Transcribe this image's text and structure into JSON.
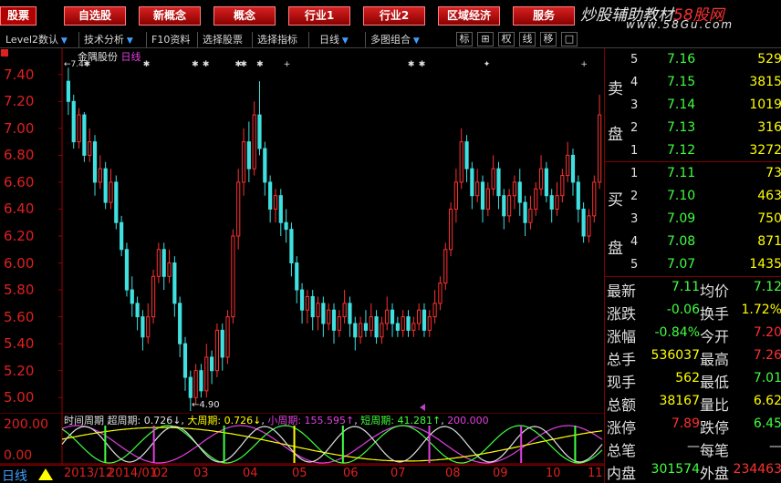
{
  "topbar": {
    "buttons": [
      "股票",
      "自选股",
      "新概念",
      "概念",
      "行业1",
      "行业2",
      "区域经济",
      "服务"
    ]
  },
  "brand": {
    "title_prefix": "炒股辅助教材",
    "title_highlight": "58股网",
    "url": "www.58Gu.com"
  },
  "toolbar": {
    "items": [
      "Level2数认",
      "技术分析",
      "F10资料",
      "选择股票",
      "选择指标",
      "日线",
      "多图组合"
    ],
    "small_buttons": [
      "标",
      "⊞",
      "权",
      "线",
      "移",
      "□"
    ]
  },
  "chart": {
    "stock_name": "金隅股份",
    "period": "日线",
    "max_label": "7.4",
    "min_label": "4.90",
    "y_labels": [
      "7.40",
      "7.20",
      "7.00",
      "6.80",
      "6.60",
      "6.40",
      "6.20",
      "6.00",
      "5.80",
      "5.60",
      "5.40",
      "5.20",
      "5.00"
    ],
    "colors": {
      "up": "#ff3030",
      "down": "#40e0e0",
      "axis": "#e02020",
      "grid": "#800000"
    }
  },
  "chart_data": {
    "type": "candlestick",
    "ylim": [
      4.9,
      7.5
    ],
    "candles": [
      [
        7.35,
        7.2,
        7.45,
        7.1
      ],
      [
        7.2,
        6.9,
        7.25,
        6.85
      ],
      [
        6.9,
        7.1,
        7.15,
        6.85
      ],
      [
        7.1,
        6.8,
        7.12,
        6.75
      ],
      [
        6.8,
        6.9,
        7.0,
        6.75
      ],
      [
        6.9,
        6.6,
        6.95,
        6.5
      ],
      [
        6.6,
        6.7,
        6.8,
        6.55
      ],
      [
        6.7,
        6.45,
        6.75,
        6.4
      ],
      [
        6.45,
        6.6,
        6.7,
        6.4
      ],
      [
        6.6,
        6.3,
        6.65,
        6.25
      ],
      [
        6.3,
        6.1,
        6.35,
        6.05
      ],
      [
        6.1,
        5.8,
        6.15,
        5.75
      ],
      [
        5.8,
        5.7,
        5.9,
        5.6
      ],
      [
        5.7,
        5.6,
        5.75,
        5.5
      ],
      [
        5.6,
        5.45,
        5.65,
        5.35
      ],
      [
        5.45,
        5.6,
        5.7,
        5.4
      ],
      [
        5.6,
        5.9,
        5.95,
        5.55
      ],
      [
        5.9,
        6.1,
        6.15,
        5.85
      ],
      [
        6.1,
        5.9,
        6.15,
        5.8
      ],
      [
        5.9,
        6.0,
        6.1,
        5.85
      ],
      [
        6.0,
        5.7,
        6.05,
        5.6
      ],
      [
        5.7,
        5.4,
        5.75,
        5.3
      ],
      [
        5.4,
        5.15,
        5.45,
        5.05
      ],
      [
        5.15,
        5.0,
        5.2,
        4.9
      ],
      [
        5.0,
        5.2,
        5.25,
        4.95
      ],
      [
        5.2,
        5.05,
        5.25,
        5.0
      ],
      [
        5.05,
        5.3,
        5.4,
        5.0
      ],
      [
        5.3,
        5.2,
        5.35,
        5.1
      ],
      [
        5.2,
        5.5,
        5.55,
        5.15
      ],
      [
        5.5,
        5.3,
        5.55,
        5.2
      ],
      [
        5.3,
        5.6,
        5.65,
        5.25
      ],
      [
        5.6,
        6.2,
        6.25,
        5.55
      ],
      [
        6.2,
        6.6,
        6.7,
        6.1
      ],
      [
        6.6,
        6.9,
        7.0,
        6.5
      ],
      [
        6.9,
        6.7,
        7.05,
        6.6
      ],
      [
        6.7,
        7.1,
        7.2,
        6.65
      ],
      [
        7.1,
        6.85,
        7.35,
        6.8
      ],
      [
        6.85,
        6.6,
        6.9,
        6.5
      ],
      [
        6.6,
        6.4,
        6.65,
        6.3
      ],
      [
        6.4,
        6.5,
        6.55,
        6.3
      ],
      [
        6.5,
        6.3,
        6.55,
        6.2
      ],
      [
        6.3,
        6.25,
        6.4,
        6.15
      ],
      [
        6.25,
        6.0,
        6.3,
        5.9
      ],
      [
        6.0,
        5.8,
        6.05,
        5.7
      ],
      [
        5.8,
        5.65,
        5.85,
        5.55
      ],
      [
        5.65,
        5.75,
        5.8,
        5.55
      ],
      [
        5.75,
        5.6,
        5.8,
        5.5
      ],
      [
        5.6,
        5.7,
        5.75,
        5.5
      ],
      [
        5.7,
        5.55,
        5.75,
        5.45
      ],
      [
        5.55,
        5.65,
        5.7,
        5.5
      ],
      [
        5.65,
        5.5,
        5.7,
        5.4
      ],
      [
        5.5,
        5.6,
        5.65,
        5.45
      ],
      [
        5.6,
        5.7,
        5.8,
        5.55
      ],
      [
        5.7,
        5.55,
        5.75,
        5.45
      ],
      [
        5.55,
        5.45,
        5.6,
        5.35
      ],
      [
        5.45,
        5.55,
        5.6,
        5.4
      ],
      [
        5.55,
        5.5,
        5.65,
        5.45
      ],
      [
        5.5,
        5.6,
        5.7,
        5.45
      ],
      [
        5.6,
        5.45,
        5.65,
        5.4
      ],
      [
        5.45,
        5.55,
        5.6,
        5.4
      ],
      [
        5.55,
        5.65,
        5.75,
        5.5
      ],
      [
        5.65,
        5.55,
        5.7,
        5.45
      ],
      [
        5.55,
        5.5,
        5.6,
        5.45
      ],
      [
        5.5,
        5.6,
        5.65,
        5.45
      ],
      [
        5.6,
        5.5,
        5.65,
        5.45
      ],
      [
        5.5,
        5.55,
        5.6,
        5.45
      ],
      [
        5.55,
        5.65,
        5.7,
        5.5
      ],
      [
        5.65,
        5.5,
        5.7,
        5.45
      ],
      [
        5.5,
        5.6,
        5.65,
        5.45
      ],
      [
        5.6,
        5.7,
        5.8,
        5.55
      ],
      [
        5.7,
        5.85,
        5.9,
        5.65
      ],
      [
        5.85,
        6.1,
        6.15,
        5.8
      ],
      [
        6.1,
        6.4,
        6.45,
        6.05
      ],
      [
        6.4,
        6.6,
        6.7,
        6.3
      ],
      [
        6.6,
        6.9,
        7.0,
        6.55
      ],
      [
        6.9,
        6.7,
        6.95,
        6.6
      ],
      [
        6.7,
        6.5,
        6.75,
        6.4
      ],
      [
        6.5,
        6.6,
        6.7,
        6.45
      ],
      [
        6.6,
        6.4,
        6.65,
        6.3
      ],
      [
        6.4,
        6.55,
        6.6,
        6.35
      ],
      [
        6.55,
        6.7,
        6.8,
        6.5
      ],
      [
        6.7,
        6.5,
        6.75,
        6.4
      ],
      [
        6.5,
        6.35,
        6.55,
        6.25
      ],
      [
        6.35,
        6.5,
        6.55,
        6.3
      ],
      [
        6.5,
        6.6,
        6.65,
        6.4
      ],
      [
        6.6,
        6.45,
        6.7,
        6.35
      ],
      [
        6.45,
        6.3,
        6.5,
        6.2
      ],
      [
        6.3,
        6.4,
        6.5,
        6.25
      ],
      [
        6.4,
        6.55,
        6.6,
        6.35
      ],
      [
        6.55,
        6.7,
        6.8,
        6.5
      ],
      [
        6.7,
        6.5,
        6.75,
        6.45
      ],
      [
        6.5,
        6.4,
        6.55,
        6.3
      ],
      [
        6.4,
        6.5,
        6.6,
        6.35
      ],
      [
        6.5,
        6.65,
        6.7,
        6.45
      ],
      [
        6.65,
        6.8,
        6.9,
        6.6
      ],
      [
        6.8,
        6.6,
        6.85,
        6.5
      ],
      [
        6.6,
        6.4,
        6.65,
        6.3
      ],
      [
        6.4,
        6.2,
        6.45,
        6.15
      ],
      [
        6.2,
        6.35,
        6.4,
        6.15
      ],
      [
        6.35,
        6.6,
        6.65,
        6.3
      ],
      [
        6.6,
        7.1,
        7.25,
        6.55
      ]
    ],
    "indicator": {
      "name": "时间周期",
      "super_label": "超周期: 0.726↓",
      "big_label": "大周期: 0.726↓",
      "small_label": "小周期: 155.595↑",
      "short_label": "短周期: 41.281↑",
      "value_label": "200.000",
      "ylim": [
        0,
        200
      ],
      "y_labels": [
        "200.00",
        "0.00"
      ]
    },
    "months": [
      "2013/12",
      "2014/01",
      "02",
      "03",
      "04",
      "05",
      "06",
      "07",
      "08",
      "09",
      "10",
      "11"
    ]
  },
  "bottombar": {
    "period": "日线"
  },
  "order_book": {
    "sell_label": [
      "卖",
      "盘"
    ],
    "buy_label": [
      "买",
      "盘"
    ],
    "sell": [
      {
        "idx": "5",
        "price": "7.16",
        "vol": "529"
      },
      {
        "idx": "4",
        "price": "7.15",
        "vol": "3815"
      },
      {
        "idx": "3",
        "price": "7.14",
        "vol": "1019"
      },
      {
        "idx": "2",
        "price": "7.13",
        "vol": "316"
      },
      {
        "idx": "1",
        "price": "7.12",
        "vol": "3272"
      }
    ],
    "buy": [
      {
        "idx": "1",
        "price": "7.11",
        "vol": "73"
      },
      {
        "idx": "2",
        "price": "7.10",
        "vol": "463"
      },
      {
        "idx": "3",
        "price": "7.09",
        "vol": "750"
      },
      {
        "idx": "4",
        "price": "7.08",
        "vol": "871"
      },
      {
        "idx": "5",
        "price": "7.07",
        "vol": "1435"
      }
    ]
  },
  "stats": [
    {
      "l1": "最新",
      "v1": "7.11",
      "c1": "#40ff40",
      "l2": "均价",
      "v2": "7.12",
      "c2": "#40ff40"
    },
    {
      "l1": "涨跌",
      "v1": "-0.06",
      "c1": "#40ff40",
      "l2": "换手",
      "v2": "1.72%",
      "c2": "#ffff00"
    },
    {
      "l1": "涨幅",
      "v1": "-0.84%",
      "c1": "#40ff40",
      "l2": "今开",
      "v2": "7.20",
      "c2": "#ff3030"
    },
    {
      "l1": "总手",
      "v1": "536037",
      "c1": "#ffff00",
      "l2": "最高",
      "v2": "7.26",
      "c2": "#ff3030"
    },
    {
      "l1": "现手",
      "v1": "562",
      "c1": "#ffff00",
      "l2": "最低",
      "v2": "7.01",
      "c2": "#40ff40"
    },
    {
      "l1": "总额",
      "v1": "38167",
      "c1": "#ffff00",
      "l2": "量比",
      "v2": "6.62",
      "c2": "#ffff00"
    },
    {
      "l1": "涨停",
      "v1": "7.89",
      "c1": "#ff3030",
      "l2": "跌停",
      "v2": "6.45",
      "c2": "#40ff40"
    },
    {
      "l1": "总笔",
      "v1": "",
      "c1": "#e0e0e0",
      "l2": "每笔",
      "v2": "",
      "c2": "#e0e0e0"
    },
    {
      "l1": "内盘",
      "v1": "301574",
      "c1": "#40ff40",
      "l2": "外盘",
      "v2": "234463",
      "c2": "#ff3030"
    }
  ]
}
